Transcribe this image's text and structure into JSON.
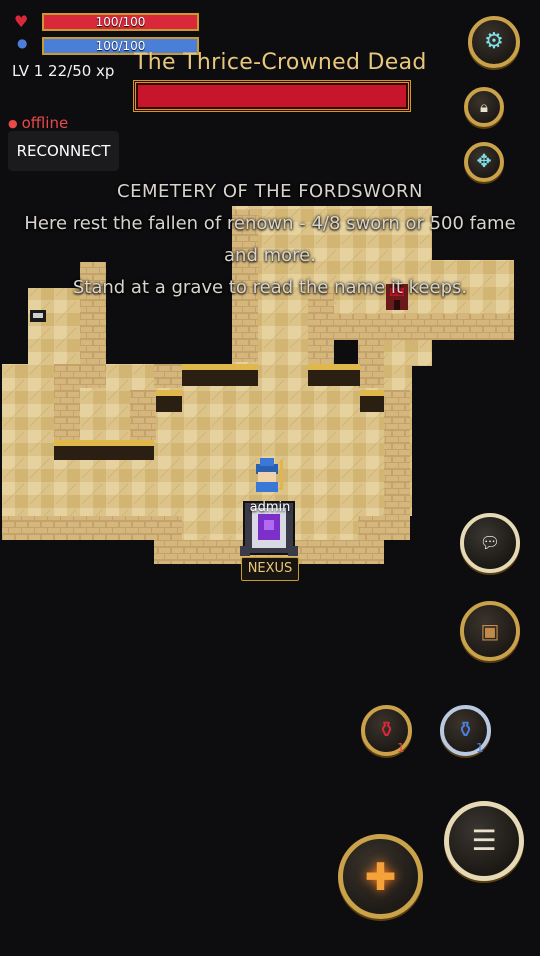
{
  "hud": {
    "hp_text": "100/100",
    "hp_fraction": 1.0,
    "mp_text": "100/100",
    "mp_fraction": 1.0,
    "level_line": "LV 1  22/50 xp"
  },
  "boss": {
    "name": "The Thrice-Crowned Dead",
    "hp_fraction": 1.0
  },
  "connection": {
    "status": "offline",
    "reconnect_label": "RECONNECT"
  },
  "messages": {
    "zone_title": "CEMETERY OF THE FORDSWORN",
    "line1": "Here rest the fallen of renown - 4/8 sworn or 500 fame",
    "line2": "and more.",
    "line3": "Stand at a grave to read the name it keeps."
  },
  "player": {
    "name": "admin"
  },
  "portal": {
    "label": "NEXUS"
  },
  "buttons": {
    "settings_icon": "gear-icon",
    "lock_icon": "lock-icon",
    "target_icon": "crosshair-icon",
    "chat_icon": "chat-icon",
    "inventory_icon": "backpack-icon",
    "ability_icon": "sparkle-icon",
    "dash_icon": "speed-icon"
  },
  "potions": {
    "health": {
      "count": "1",
      "color": "#d8283a"
    },
    "mana": {
      "count": "1",
      "color": "#4a7ed8"
    }
  },
  "colors": {
    "accent_gold": "#c99a2e",
    "hp_red": "#d8283a",
    "mp_blue": "#4a7ed8",
    "boss_red": "#c7152b",
    "sand": "#dcc38a",
    "sand_light": "#e9d8a8",
    "sand_dark": "#c9a75a",
    "brick": "#c4a36a"
  }
}
